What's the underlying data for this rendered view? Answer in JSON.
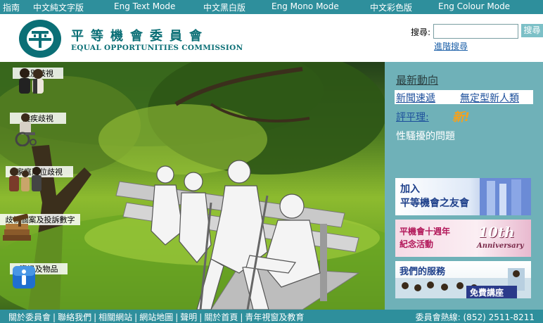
{
  "topbar": {
    "guide": "指南",
    "zh_text": "中文純文字版",
    "en_text": "Eng Text Mode",
    "zh_mono": "中文黑白版",
    "en_mono": "Eng Mono Mode",
    "zh_colour": "中文彩色版",
    "en_colour": "Eng Colour Mode"
  },
  "header": {
    "logo_zh": "平等機會委員會",
    "logo_en": "EQUAL OPPORTUNITIES COMMISSION",
    "search_label": "搜尋:",
    "search_value": "",
    "search_button": "搜尋",
    "advanced_search": "進階搜尋"
  },
  "sidebar": {
    "items": [
      {
        "label": "性別歧視",
        "icon": "gender-icon"
      },
      {
        "label": "殘疾歧視",
        "icon": "wheelchair-icon"
      },
      {
        "label": "家庭崗位歧視",
        "icon": "family-icon"
      },
      {
        "label": "歧視個案及投訴數字",
        "icon": "books-gavel-icon"
      },
      {
        "label": "資訊及物品",
        "icon": "info-icon"
      }
    ]
  },
  "panel": {
    "news_title": "最新動向",
    "news_express": "新聞速遞",
    "news_feature": "無定型新人類",
    "comment": "評平理:",
    "new_badge": "新!",
    "harassment": "性騷擾的問題"
  },
  "banners": [
    {
      "text": "加入\n平等機會之友會",
      "line1": "加入",
      "line2": "平等機會之友會"
    },
    {
      "line1": "平機會十週年",
      "line2": "紀念活動",
      "accent": "10th",
      "accent2": "Anniversary"
    },
    {
      "line1": "我們的服務",
      "accent": "免費講座"
    }
  ],
  "footer": {
    "links": [
      "關於委員會",
      "聯絡我們",
      "相關網站",
      "網站地圖",
      "聲明",
      "關於首頁",
      "青年視窗及教育"
    ],
    "hotline": "委員會熱線: (852) 2511-8211"
  },
  "colors": {
    "bar": "#2e8f9c",
    "panel": "#6fb1b8",
    "brand": "#0b6f76"
  }
}
